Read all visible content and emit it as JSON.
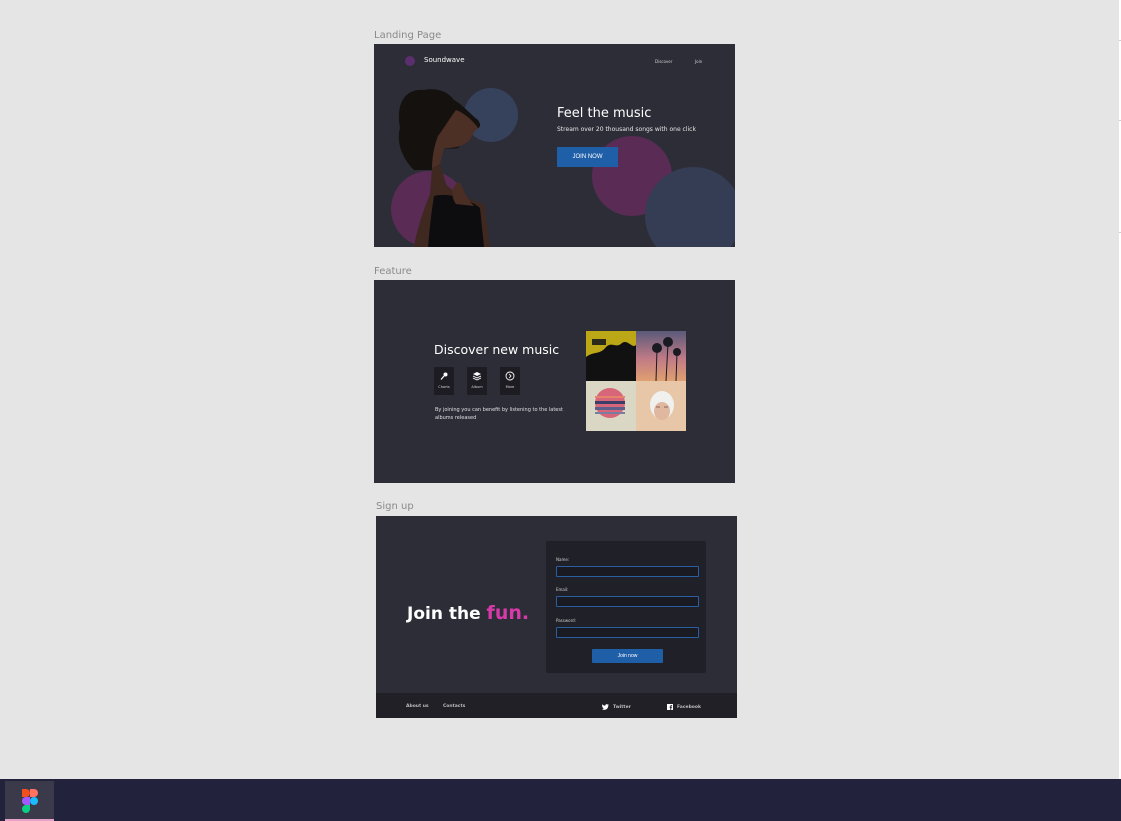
{
  "frames": {
    "landing": {
      "label": "Landing Page",
      "brand": "Soundwave",
      "nav": [
        "Discover",
        "Join"
      ],
      "hero_title": "Feel the music",
      "hero_subtitle": "Stream over 20 thousand songs with one click",
      "cta": "JOIN NOW"
    },
    "feature": {
      "label": "Feature",
      "title": "Discover new music",
      "icons": [
        {
          "label": "Charts",
          "icon": "microphone-icon"
        },
        {
          "label": "Album",
          "icon": "layers-icon"
        },
        {
          "label": "More",
          "icon": "circle-arrow-icon"
        }
      ],
      "description": "By joining you can benefit by listening to the latest albums released"
    },
    "signup": {
      "label": "Sign up",
      "heading": "Join the",
      "heading_accent": "fun.",
      "fields": [
        {
          "label": "Name:",
          "value": ""
        },
        {
          "label": "Email:",
          "value": ""
        },
        {
          "label": "Password:",
          "value": ""
        }
      ],
      "submit": "Join now",
      "footer": {
        "about": "About us",
        "contacts": "Contacts",
        "twitter": "Twitter",
        "facebook": "Facebook"
      }
    }
  },
  "colors": {
    "canvas": "#e5e5e5",
    "frame_bg": "#2d2d37",
    "accent_blue": "#1f5fa8",
    "accent_pink": "#d63aa8",
    "taskbar": "#22223d"
  },
  "taskbar": {
    "app_icon": "figma-icon"
  }
}
